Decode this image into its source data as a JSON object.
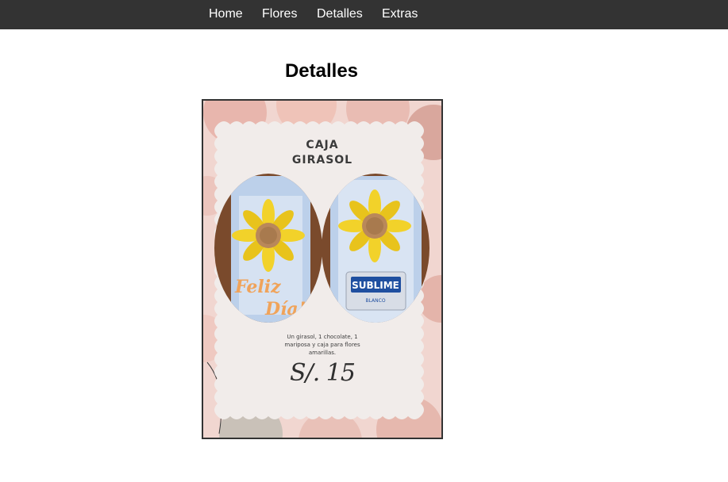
{
  "nav": {
    "items": [
      {
        "label": "Home"
      },
      {
        "label": "Flores"
      },
      {
        "label": "Detalles"
      },
      {
        "label": "Extras"
      }
    ]
  },
  "page": {
    "title": "Detalles"
  },
  "product_card": {
    "title_line1": "CAJA",
    "title_line2": "GIRASOL",
    "description": "Un girasol, 1 chocolate, 1 mariposa y caja para flores amarillas.",
    "price": "S/. 15",
    "photo_left_text_line1": "Feliz",
    "photo_left_text_line2": "Día!",
    "photo_right_brand": "SUBLIME",
    "photo_right_brand_sub": "BLANCO"
  },
  "colors": {
    "nav_bg": "#333333",
    "nav_text": "#ffffff",
    "card_paper": "#f1ecea",
    "card_bg": "#f1d6d0",
    "sunflower": "#f2d22a",
    "sunflower_center": "#b9885a"
  }
}
